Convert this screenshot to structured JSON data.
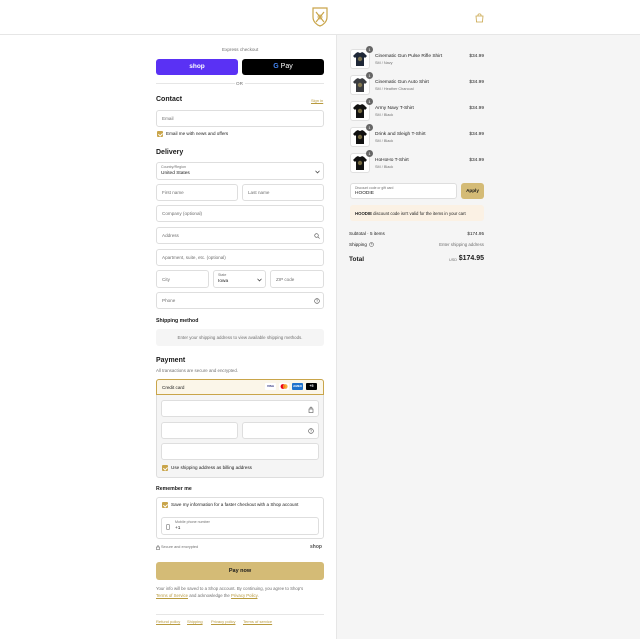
{
  "express": {
    "title": "Express checkout",
    "shop_label": "shop",
    "gpay_g": "G",
    "gpay_label": "Pay",
    "or": "OR"
  },
  "contact": {
    "heading": "Contact",
    "signin": "Sign in",
    "email_placeholder": "Email",
    "news_label": "Email me with news and offers"
  },
  "delivery": {
    "heading": "Delivery",
    "country_label": "Country/Region",
    "country_value": "United States",
    "first_name": "First name",
    "last_name": "Last name",
    "company": "Company (optional)",
    "address": "Address",
    "apartment": "Apartment, suite, etc. (optional)",
    "city": "City",
    "state_label": "State",
    "state_value": "Iowa",
    "zip": "ZIP code",
    "phone": "Phone"
  },
  "shipping": {
    "heading": "Shipping method",
    "notice": "Enter your shipping address to view available shipping methods."
  },
  "payment": {
    "heading": "Payment",
    "subtitle": "All transactions are secure and encrypted.",
    "credit_card": "Credit card",
    "card_visa": "VISA",
    "card_amex": "AMEX",
    "card_more": "+5",
    "billing_label": "Use shipping address as billing address"
  },
  "remember": {
    "heading": "Remember me",
    "save_label": "Save my information for a faster checkout with a Shop account",
    "mobile_label": "Mobile phone number",
    "mobile_value": "+1",
    "secure": "Secure and encrypted",
    "shop": "shop"
  },
  "pay_button": "Pay now",
  "legal": {
    "line1": "Your info will be saved to a Shop account. By continuing, you agree to Shop's",
    "tos": "Terms of Service",
    "and": "and acknowledge the",
    "privacy": "Privacy Policy",
    "period": "."
  },
  "footer_links": [
    "Refund policy",
    "Shipping",
    "Privacy policy",
    "Terms of service"
  ],
  "cart": {
    "items": [
      {
        "name": "Cinematic Gun Pulse Rifle Shirt",
        "variant": "SM / Navy",
        "price": "$34.99",
        "qty": "1",
        "shirt_color": "#1f2838"
      },
      {
        "name": "Cinematic Gun Auto Shirt",
        "variant": "SM / Heather Charcoal",
        "price": "$34.99",
        "qty": "1",
        "shirt_color": "#3a3c40"
      },
      {
        "name": "Army Navy T-Shirt",
        "variant": "SM / Black",
        "price": "$34.99",
        "qty": "1",
        "shirt_color": "#111111"
      },
      {
        "name": "Drink and Sleigh T-Shirt",
        "variant": "SM / Black",
        "price": "$34.99",
        "qty": "1",
        "shirt_color": "#111111"
      },
      {
        "name": "HoHoHo T-Shirt",
        "variant": "SM / Black",
        "price": "$34.99",
        "qty": "1",
        "shirt_color": "#111111"
      }
    ],
    "discount_label": "Discount code or gift card",
    "discount_value": "HOODIE",
    "apply": "Apply",
    "error_code": "HOODIE",
    "error_text": " discount code isn't valid for the items in your cart",
    "subtotal_label": "Subtotal · 5 items",
    "subtotal_value": "$174.95",
    "shipping_label": "Shipping",
    "shipping_value": "Enter shipping address",
    "total_label": "Total",
    "currency": "USD",
    "total_value": "$174.95"
  },
  "colors": {
    "accent": "#c9a54a",
    "shop_purple": "#5a31f4"
  }
}
